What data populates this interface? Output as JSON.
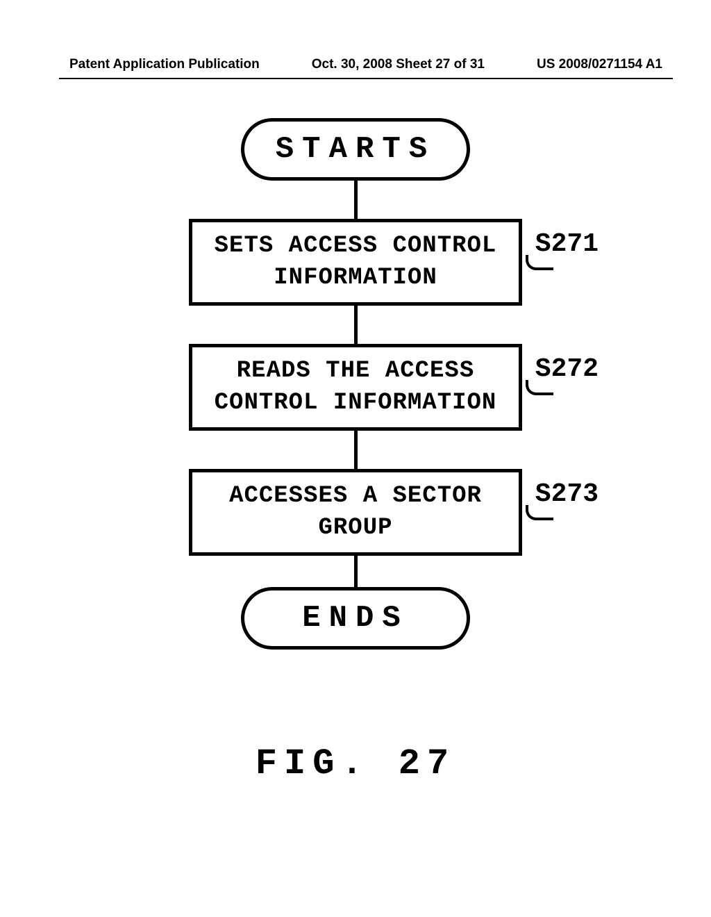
{
  "header": {
    "left": "Patent Application Publication",
    "center": "Oct. 30, 2008  Sheet 27 of 31",
    "right": "US 2008/0271154 A1"
  },
  "flowchart": {
    "start": "STARTS",
    "end": "ENDS",
    "steps": [
      {
        "label": "S271",
        "text": "SETS ACCESS CONTROL INFORMATION"
      },
      {
        "label": "S272",
        "text": "READS THE ACCESS CONTROL INFORMATION"
      },
      {
        "label": "S273",
        "text": "ACCESSES A SECTOR GROUP"
      }
    ]
  },
  "caption": "FIG.  27"
}
